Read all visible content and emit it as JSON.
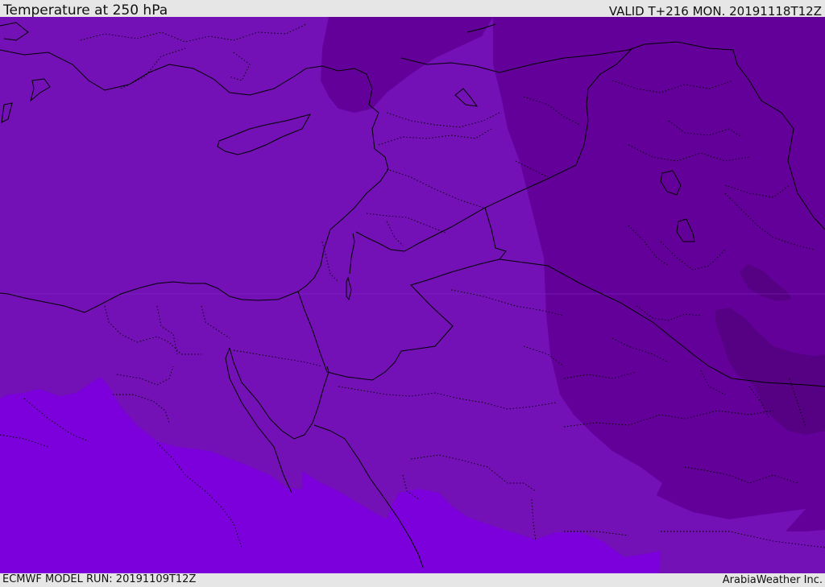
{
  "header": {
    "title": "Temperature at 250 hPa",
    "valid": "VALID T+216 MON. 20191118T12Z"
  },
  "footer": {
    "model_run": "ECMWF MODEL RUN: 20191109T12Z",
    "credit": "ArabiaWeather Inc."
  },
  "colors": {
    "background": "#e6e6e6",
    "band_warm": "#7b00db",
    "band_main": "#7310b6",
    "band_cool": "#64009a",
    "band_cold": "#560083",
    "boundary": "#000000"
  }
}
